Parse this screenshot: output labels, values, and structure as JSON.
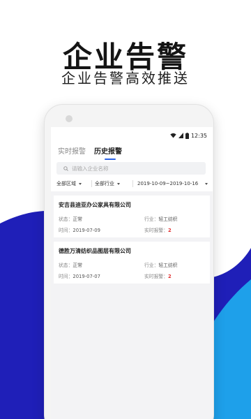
{
  "promo": {
    "headline": "企业告警",
    "subheadline": "企业告警高效推送"
  },
  "colors": {
    "accent": "#2a62e6",
    "wave_dark": "#1f1fb8",
    "wave_light": "#1ea0ea",
    "alarm": "#e23030"
  },
  "status_bar": {
    "time": "12:35",
    "icons": [
      "wifi-icon",
      "signal-icon",
      "battery-icon"
    ]
  },
  "tabs": [
    {
      "label": "实时报警",
      "active": false
    },
    {
      "label": "历史报警",
      "active": true
    }
  ],
  "search": {
    "placeholder": "请输入企业名称",
    "value": ""
  },
  "filters": {
    "area": "全部区域",
    "industry": "全部行业",
    "date_range": "2019-10-09~2019-10-16"
  },
  "records": [
    {
      "company": "安吉县迪亚办公家具有限公司",
      "status_label": "状态：",
      "status": "正常",
      "industry_label": "行业：",
      "industry": "轻工纺织",
      "time_label": "时间：",
      "time": "2019-07-09",
      "alarm_label": "实时报警：",
      "alarm_count": "2"
    },
    {
      "company": "德胜万清纺织品图层有限公司",
      "status_label": "状态：",
      "status": "正常",
      "industry_label": "行业：",
      "industry": "轻工纺织",
      "time_label": "时间：",
      "time": "2019-07-07",
      "alarm_label": "实时报警：",
      "alarm_count": "2"
    }
  ]
}
